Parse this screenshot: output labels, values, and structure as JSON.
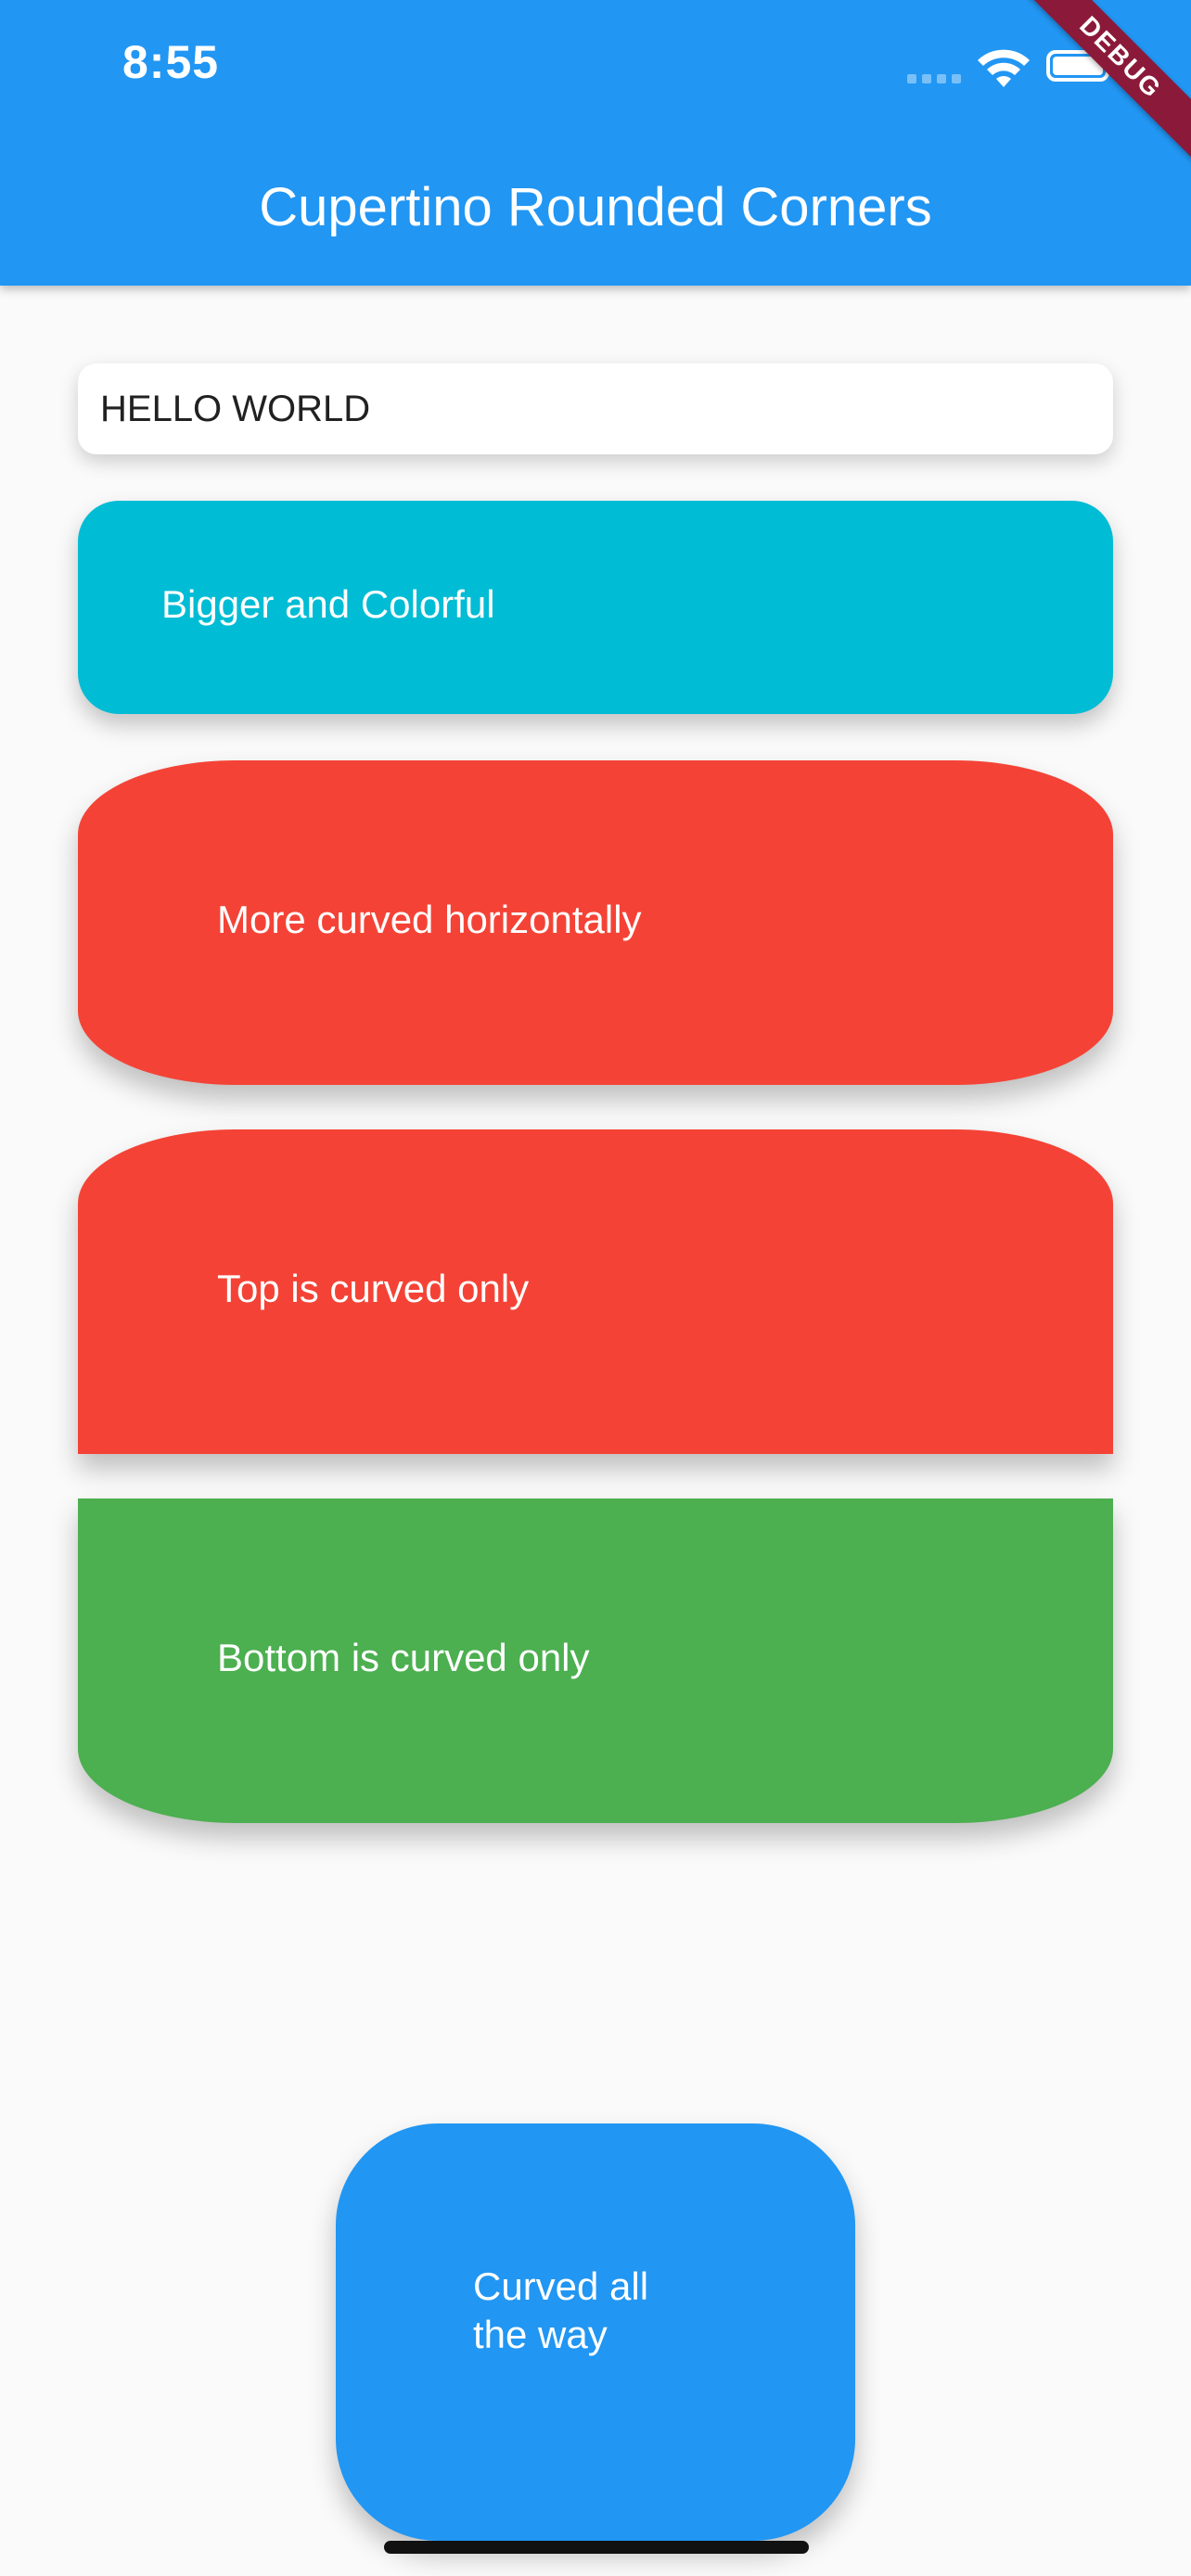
{
  "status_bar": {
    "time": "8:55",
    "icons": [
      "cellular-signal-icon",
      "wifi-icon",
      "battery-icon"
    ]
  },
  "debug_banner": "DEBUG",
  "app_bar": {
    "title": "Cupertino Rounded Corners",
    "color": "#2196f3"
  },
  "cards": {
    "hello": "HELLO WORLD",
    "cyan": {
      "label": "Bigger and Colorful",
      "color": "#00bcd4"
    },
    "horizontal": {
      "label": "More curved horizontally",
      "color": "#f44336"
    },
    "top_only": {
      "label": "Top is curved only",
      "color": "#f44336"
    },
    "bottom_only": {
      "label": "Bottom is curved only",
      "color": "#4caf50"
    },
    "all_the_way": {
      "label": "Curved all the way",
      "color": "#2196f3"
    }
  }
}
